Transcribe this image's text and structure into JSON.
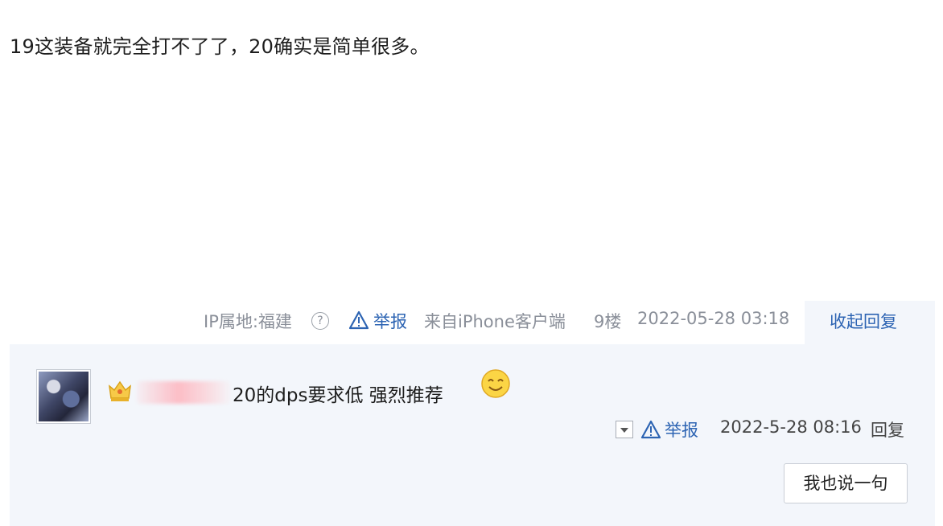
{
  "post": {
    "text": "19这装备就完全打不了了，20确实是简单很多。"
  },
  "meta": {
    "ip": "IP属地:福建",
    "help_glyph": "?",
    "report": "举报",
    "client": "来自iPhone客户端",
    "floor": "9楼",
    "time": "2022-05-28 03:18",
    "collapse": "收起回复"
  },
  "reply": {
    "text": "20的dps要求低 强烈推荐",
    "report": "举报",
    "time": "2022-5-28 08:16",
    "reply_label": "回复",
    "say_button": "我也说一句"
  },
  "colors": {
    "link": "#2d64b3",
    "meta_gray": "#8a8f99",
    "panel_bg": "#f3f6fb"
  },
  "icons": [
    "help-icon",
    "warning-triangle-icon",
    "crown-icon",
    "smile-emoji-icon",
    "dropdown-arrow-icon"
  ]
}
